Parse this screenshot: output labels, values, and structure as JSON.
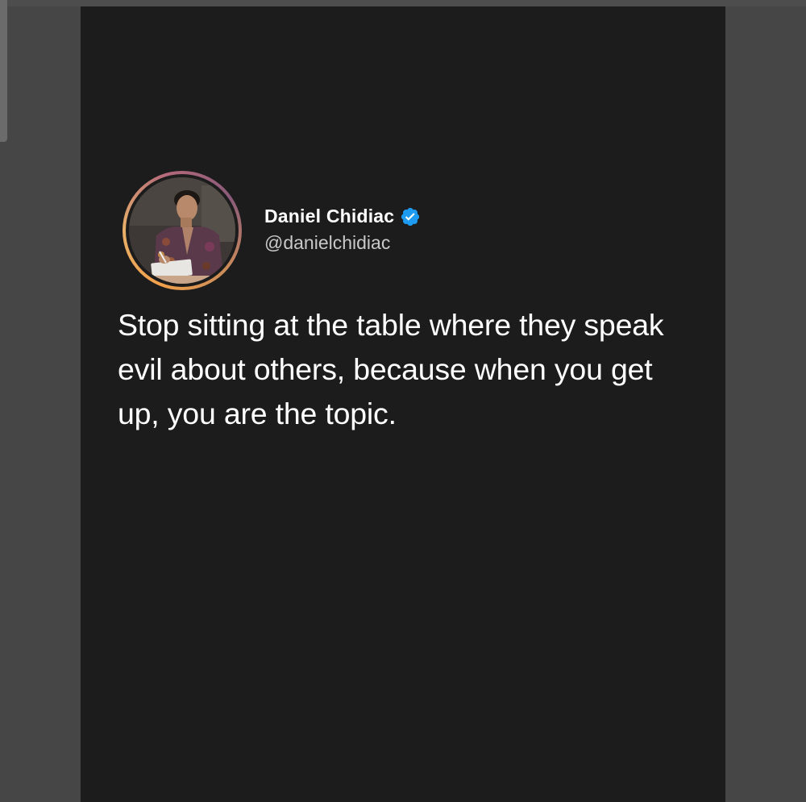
{
  "post": {
    "author": {
      "display_name": "Daniel Chidiac",
      "handle": "@danielchidiac",
      "verified": true
    },
    "text": "Stop sitting at the table where they speak evil about others, because when you get up, you are the topic."
  },
  "colors": {
    "background": "#464646",
    "card": "#1c1c1c",
    "text": "#ffffff",
    "handle": "#c9c9c9",
    "verified_badge": "#1d9bf0"
  },
  "icons": {
    "verified": "verified-badge-icon",
    "avatar": "profile-photo"
  }
}
